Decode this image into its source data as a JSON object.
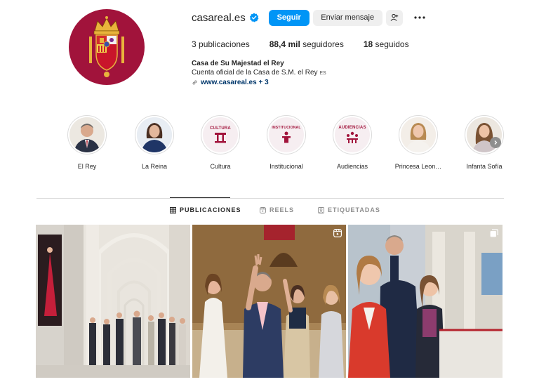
{
  "profile": {
    "username": "casareal.es",
    "follow_label": "Seguir",
    "message_label": "Enviar mensaje",
    "stats": {
      "posts_value": "3",
      "posts_label": "publicaciones",
      "followers_value": "88,4 mil",
      "followers_label": "seguidores",
      "following_value": "18",
      "following_label": "seguidos"
    },
    "bio": {
      "name": "Casa de Su Majestad el Rey",
      "description": "Cuenta oficial de la Casa de S.M. el Rey",
      "flag": "ES",
      "link": "www.casareal.es",
      "link_more": "+ 3"
    }
  },
  "highlights": [
    {
      "label": "El Rey",
      "kind": "photo",
      "caption": ""
    },
    {
      "label": "La Reina",
      "kind": "photo",
      "caption": ""
    },
    {
      "label": "Cultura",
      "kind": "badge",
      "caption": "CULTURA"
    },
    {
      "label": "Institucional",
      "kind": "badge",
      "caption": "INSTITUCIONAL"
    },
    {
      "label": "Audiencias",
      "kind": "badge",
      "caption": "AUDIENCIAS"
    },
    {
      "label": "Princesa Leon…",
      "kind": "photo",
      "caption": ""
    },
    {
      "label": "Infanta Sofía",
      "kind": "photo",
      "caption": ""
    }
  ],
  "tabs": [
    {
      "label": "PUBLICACIONES",
      "icon": "grid-icon",
      "active": true
    },
    {
      "label": "REELS",
      "icon": "reels-icon",
      "active": false
    },
    {
      "label": "ETIQUETADAS",
      "icon": "tagged-icon",
      "active": false
    }
  ],
  "posts": [
    {
      "type": "image",
      "icon": ""
    },
    {
      "type": "reel",
      "icon": "reel-icon"
    },
    {
      "type": "carousel",
      "icon": "carousel-icon"
    }
  ],
  "colors": {
    "brand": "#a1133b",
    "follow": "#0095f6",
    "verified": "#0095f6"
  }
}
